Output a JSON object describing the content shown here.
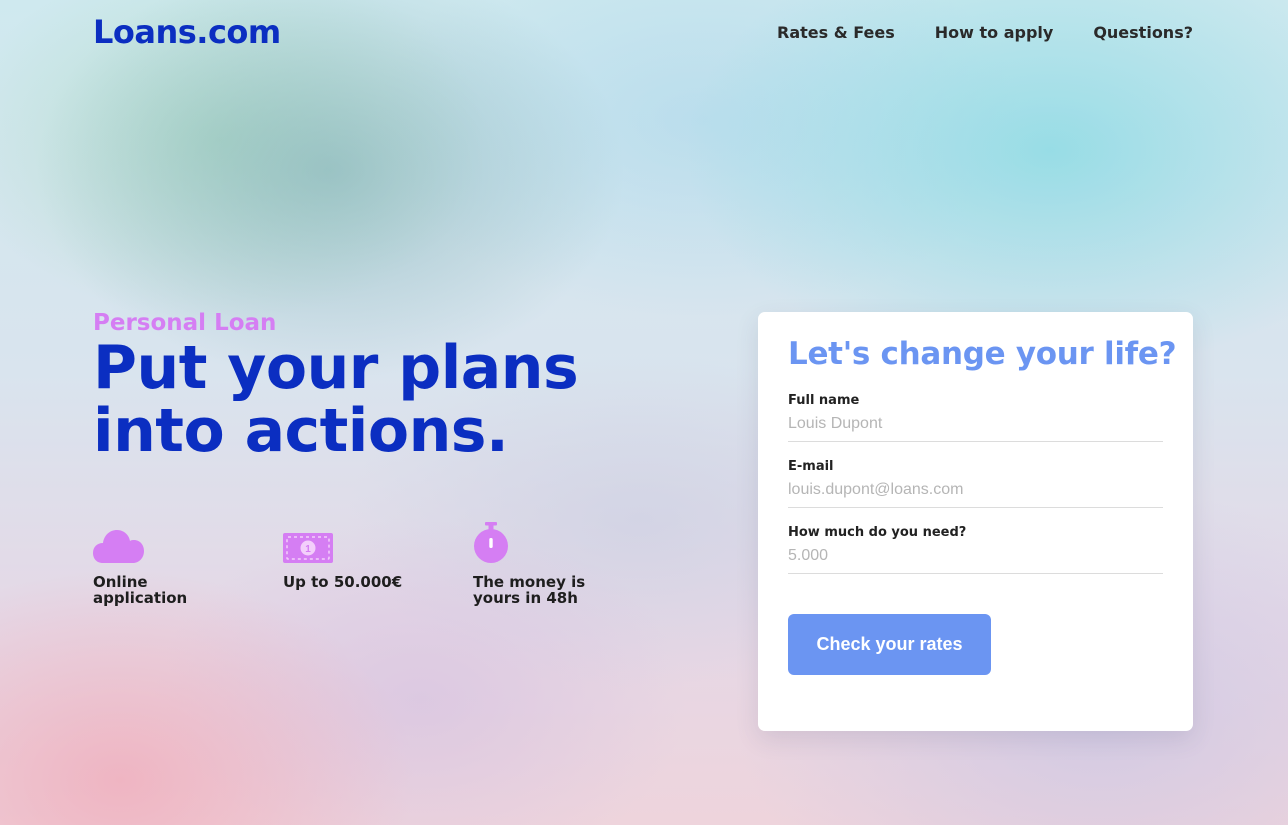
{
  "header": {
    "logo": "Loans.com",
    "nav": [
      {
        "label": "Rates & Fees"
      },
      {
        "label": "How to apply"
      },
      {
        "label": "Questions?"
      }
    ]
  },
  "hero": {
    "eyebrow": "Personal Loan",
    "headline_line1": "Put your plans",
    "headline_line2": "into actions.",
    "features": [
      {
        "icon": "cloud-icon",
        "label": "Online application"
      },
      {
        "icon": "banknote-icon",
        "label": "Up to 50.000€"
      },
      {
        "icon": "stopwatch-icon",
        "label": "The money is yours in 48h"
      }
    ]
  },
  "form": {
    "title": "Let's change your life?",
    "fields": [
      {
        "label": "Full name",
        "placeholder": "Louis Dupont"
      },
      {
        "label": "E-mail",
        "placeholder": "louis.dupont@loans.com"
      },
      {
        "label": "How much do you need?",
        "placeholder": "5.000"
      }
    ],
    "submit_label": "Check your rates"
  },
  "colors": {
    "brand": "#0b2ec1",
    "accent_purple": "#d57ef3",
    "accent_blue": "#6b95f2"
  }
}
